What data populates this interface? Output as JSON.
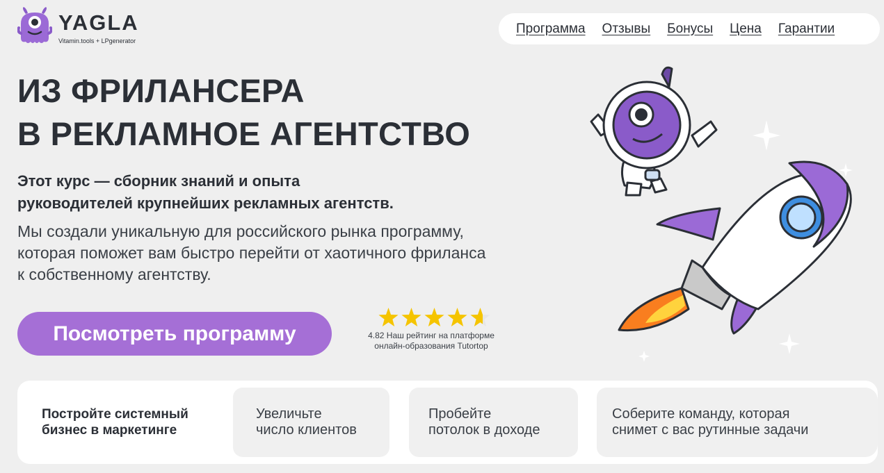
{
  "logo": {
    "word": "YAGLA",
    "subtitle": "Vitamin.tools + LPgenerator"
  },
  "nav": {
    "items": [
      "Программа",
      "Отзывы",
      "Бонусы",
      "Цена",
      "Гарантии"
    ]
  },
  "hero": {
    "title_lines": [
      "ИЗ ФРИЛАНСЕРА",
      "В РЕКЛАМНОЕ АГЕНТСТВО"
    ],
    "lead_lines": [
      "Этот курс — сборник знаний и опыта",
      "руководителей крупнейших рекламных агентств."
    ],
    "desc_lines": [
      "Мы создали уникальную для российского рынка программу,",
      "которая поможет вам быстро перейти от хаотичного фриланса",
      "к собственному агентству."
    ],
    "cta_label": "Посмотреть программу"
  },
  "rating": {
    "value": 4.82,
    "max_stars": 5,
    "text_line1": "4.82 Наш рейтинг на платформе",
    "text_line2": "онлайн-образования Tutortop"
  },
  "features": [
    {
      "lines": [
        "Постройте системный",
        "бизнес в маркетинге"
      ]
    },
    {
      "lines": [
        "Увеличьте",
        "число клиентов"
      ]
    },
    {
      "lines": [
        "Пробейте",
        "потолок в доходе"
      ]
    },
    {
      "lines": [
        "Соберите команду, которая",
        "снимет с вас рутинные задачи"
      ]
    }
  ],
  "colors": {
    "accent": "#a56fd6",
    "star": "#f5c400",
    "background": "#efefef",
    "text": "#2b2f36"
  },
  "icons": [
    "yagla-monster-logo",
    "star-icon",
    "astronaut-monster-illustration",
    "rocket-illustration",
    "sparkle-icon"
  ]
}
